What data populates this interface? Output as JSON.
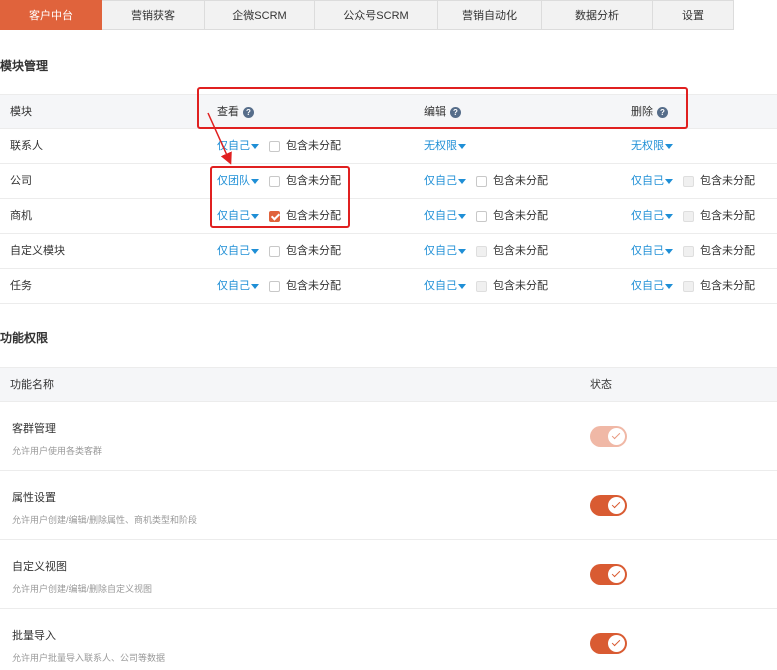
{
  "tabs": [
    "客户中台",
    "营销获客",
    "企微SCRM",
    "公众号SCRM",
    "营销自动化",
    "数据分析",
    "设置"
  ],
  "module_section_title": "模块管理",
  "module_table": {
    "headers": {
      "module": "模块",
      "view": "查看",
      "edit": "编辑",
      "delete": "删除"
    },
    "help_glyph": "?",
    "include_unassigned": "包含未分配",
    "rows": [
      {
        "name": "联系人",
        "view": {
          "value": "仅自己",
          "checkbox": "unchecked"
        },
        "edit": {
          "value": "无权限"
        },
        "delete": {
          "value": "无权限"
        }
      },
      {
        "name": "公司",
        "view": {
          "value": "仅团队",
          "checkbox": "unchecked"
        },
        "edit": {
          "value": "仅自己",
          "checkbox": "unchecked"
        },
        "delete": {
          "value": "仅自己",
          "checkbox": "disabled"
        }
      },
      {
        "name": "商机",
        "view": {
          "value": "仅自己",
          "checkbox": "checked"
        },
        "edit": {
          "value": "仅自己",
          "checkbox": "unchecked"
        },
        "delete": {
          "value": "仅自己",
          "checkbox": "disabled"
        }
      },
      {
        "name": "自定义模块",
        "view": {
          "value": "仅自己",
          "checkbox": "unchecked"
        },
        "edit": {
          "value": "仅自己",
          "checkbox": "disabled"
        },
        "delete": {
          "value": "仅自己",
          "checkbox": "disabled"
        }
      },
      {
        "name": "任务",
        "view": {
          "value": "仅自己",
          "checkbox": "unchecked"
        },
        "edit": {
          "value": "仅自己",
          "checkbox": "disabled"
        },
        "delete": {
          "value": "仅自己",
          "checkbox": "disabled"
        }
      }
    ]
  },
  "function_section_title": "功能权限",
  "function_table": {
    "headers": {
      "name": "功能名称",
      "status": "状态"
    },
    "rows": [
      {
        "title": "客群管理",
        "desc": "允许用户使用各类客群",
        "enabled": true,
        "style": "light"
      },
      {
        "title": "属性设置",
        "desc": "允许用户创建/编辑/删除属性、商机类型和阶段",
        "enabled": true,
        "style": "normal"
      },
      {
        "title": "自定义视图",
        "desc": "允许用户创建/编辑/删除自定义视图",
        "enabled": true,
        "style": "normal"
      },
      {
        "title": "批量导入",
        "desc": "允许用户批量导入联系人、公司等数据",
        "enabled": true,
        "style": "normal"
      }
    ]
  },
  "colors": {
    "accent": "#e0633c",
    "link": "#1f8fd6",
    "annotation": "#e02020"
  }
}
